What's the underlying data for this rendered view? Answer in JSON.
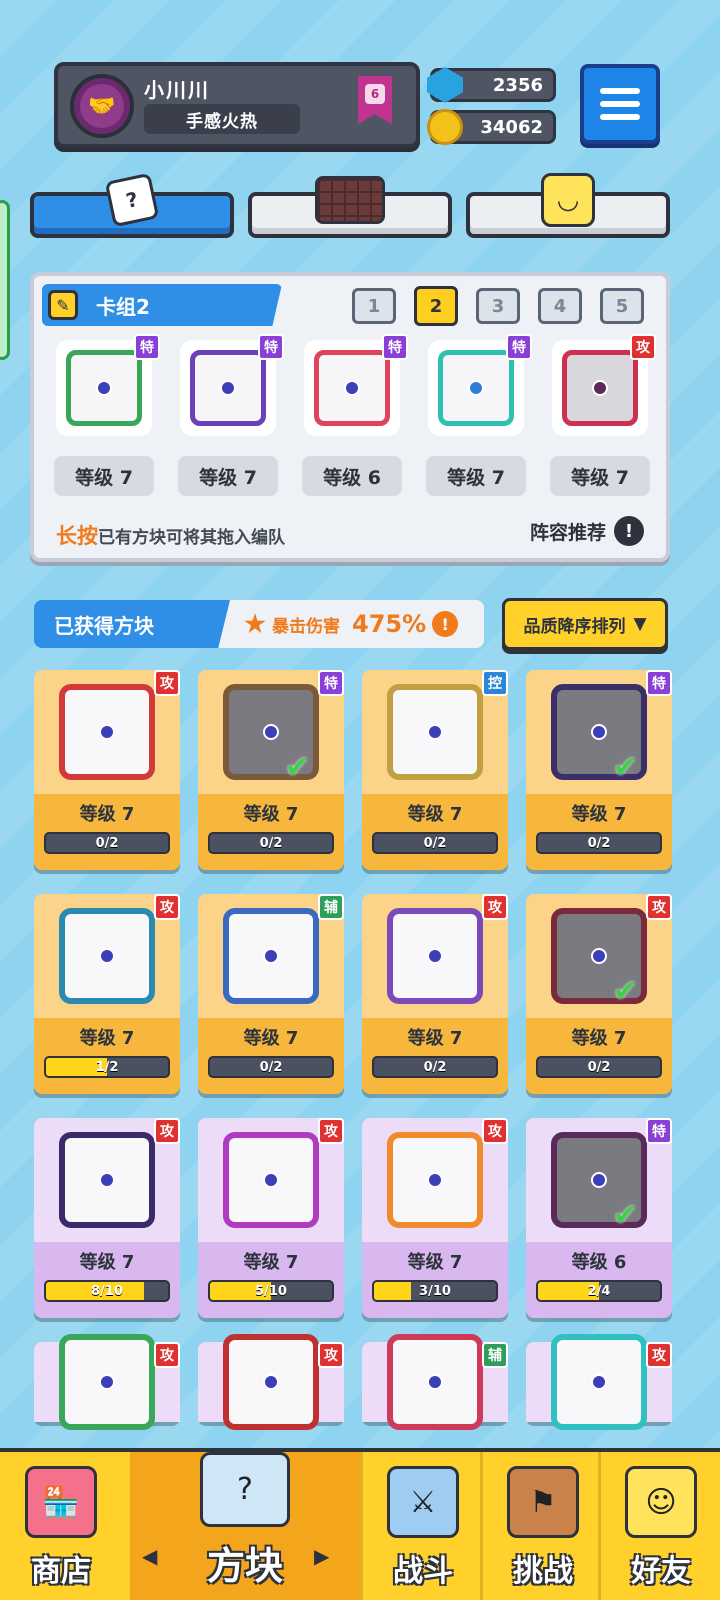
{
  "header": {
    "player_name": "小川川",
    "player_title": "手感火热",
    "rank": "6",
    "gems": "2356",
    "coins": "34062"
  },
  "top_tabs": [
    {
      "icon": "dice-icon"
    },
    {
      "icon": "board-icon"
    },
    {
      "icon": "smile-block-icon"
    }
  ],
  "deck": {
    "name": "卡组2",
    "numbers": [
      "1",
      "2",
      "3",
      "4",
      "5"
    ],
    "active_number": "2",
    "cards": [
      {
        "type": "特",
        "level": "等级 7"
      },
      {
        "type": "特",
        "level": "等级 7"
      },
      {
        "type": "特",
        "level": "等级 6"
      },
      {
        "type": "特",
        "level": "等级 7"
      },
      {
        "type": "攻",
        "level": "等级 7"
      }
    ],
    "hint_highlight": "长按",
    "hint_text": "已有方块可将其拖入编队",
    "lineup_label": "阵容推荐"
  },
  "owned": {
    "title": "已获得方块",
    "crit_label": "暴击伤害",
    "crit_value": "475%",
    "sort_label": "品质降序排列"
  },
  "blocks": [
    {
      "type": "攻",
      "level": "等级 7",
      "progress": "0/2",
      "fill": 0
    },
    {
      "type": "特",
      "level": "等级 7",
      "progress": "0/2",
      "fill": 0
    },
    {
      "type": "控",
      "level": "等级 7",
      "progress": "0/2",
      "fill": 0
    },
    {
      "type": "特",
      "level": "等级 7",
      "progress": "0/2",
      "fill": 0
    },
    {
      "type": "攻",
      "level": "等级 7",
      "progress": "1/2",
      "fill": 0.5
    },
    {
      "type": "辅",
      "level": "等级 7",
      "progress": "0/2",
      "fill": 0
    },
    {
      "type": "攻",
      "level": "等级 7",
      "progress": "0/2",
      "fill": 0
    },
    {
      "type": "攻",
      "level": "等级 7",
      "progress": "0/2",
      "fill": 0
    },
    {
      "type": "攻",
      "level": "等级 7",
      "progress": "8/10",
      "fill": 0.8
    },
    {
      "type": "攻",
      "level": "等级 7",
      "progress": "5/10",
      "fill": 0.5
    },
    {
      "type": "攻",
      "level": "等级 7",
      "progress": "3/10",
      "fill": 0.3
    },
    {
      "type": "特",
      "level": "等级 6",
      "progress": "2/4",
      "fill": 0.5
    },
    {
      "type": "攻"
    },
    {
      "type": "攻"
    },
    {
      "type": "辅"
    },
    {
      "type": "攻"
    }
  ],
  "bottom_nav": {
    "shop": "商店",
    "blocks": "方块",
    "battle": "战斗",
    "challenge": "挑战",
    "friends": "好友"
  }
}
